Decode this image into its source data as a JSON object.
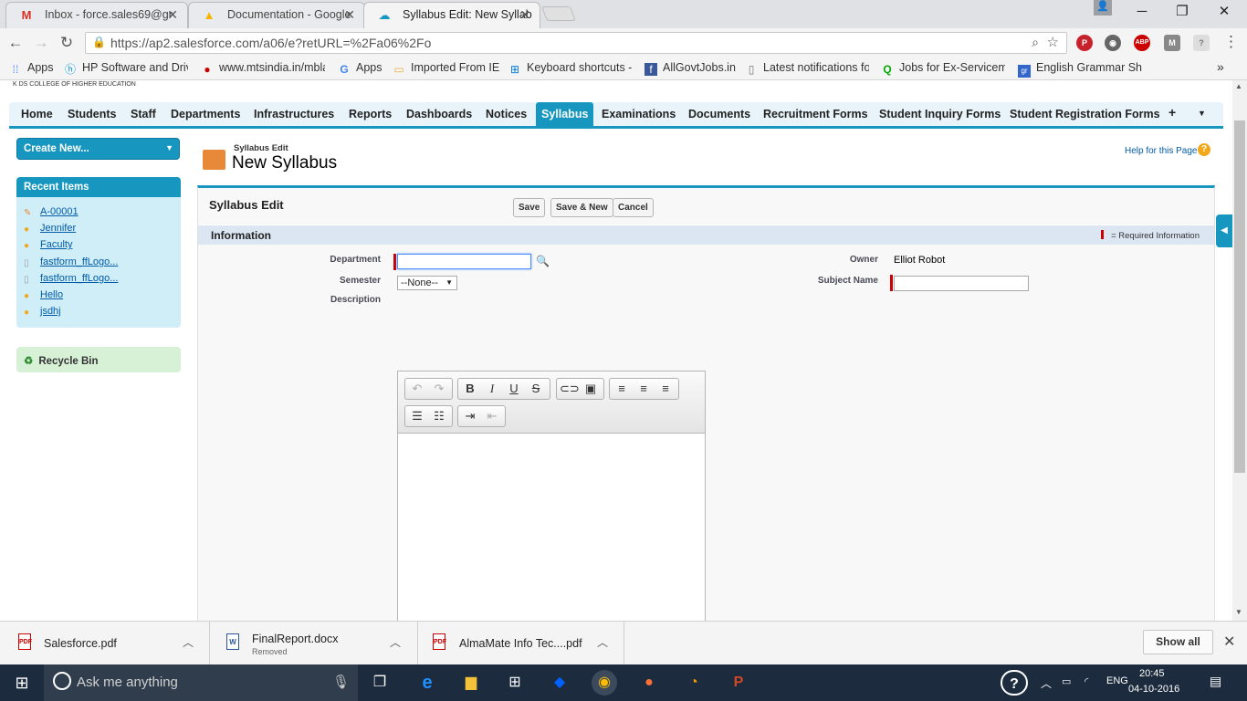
{
  "browser": {
    "tabs": [
      {
        "title": "Inbox - force.sales69@gr",
        "icon": "gmail-icon"
      },
      {
        "title": "Documentation - Google",
        "icon": "drive-icon"
      },
      {
        "title": "Syllabus Edit: New Syllab",
        "icon": "salesforce-icon"
      }
    ],
    "url": "https://ap2.salesforce.com/a06/e?retURL=%2Fa06%2Fo",
    "bookmarks": [
      {
        "label": "Apps"
      },
      {
        "label": "HP Software and Drive"
      },
      {
        "label": "www.mtsindia.in/mbla"
      },
      {
        "label": "Apps"
      },
      {
        "label": "Imported From IE"
      },
      {
        "label": "Keyboard shortcuts - W"
      },
      {
        "label": "AllGovtJobs.in"
      },
      {
        "label": "Latest notifications fo"
      },
      {
        "label": "Jobs for Ex-Serviceme"
      },
      {
        "label": "English Grammar Sho"
      }
    ],
    "bookmarks_more": "»",
    "ext_abp": "ABP"
  },
  "app": {
    "org_name": "K DS COLLEGE OF HIGHER EDUCATION",
    "tabs": [
      "Home",
      "Students",
      "Staff",
      "Departments",
      "Infrastructures",
      "Reports",
      "Dashboards",
      "Notices",
      "Syllabus",
      "Examinations",
      "Documents",
      "Recruitment Forms",
      "Student Inquiry Forms",
      "Student Registration Forms"
    ],
    "active_tab": "Syllabus",
    "plus": "+",
    "more": "▼"
  },
  "sidebar": {
    "create_new": "Create New...",
    "recent_title": "Recent Items",
    "recent_items": [
      "A-00001",
      "Jennifer",
      "Faculty",
      "fastform_ffLogo...",
      "fastform_ffLogo...",
      "Hello",
      "jsdhj"
    ],
    "recycle_bin": "Recycle Bin"
  },
  "main": {
    "breadcrumb": "Syllabus Edit",
    "title": "New Syllabus",
    "help_link": "Help for this Page",
    "panel_title": "Syllabus Edit",
    "buttons": {
      "save": "Save",
      "save_new": "Save & New",
      "cancel": "Cancel"
    },
    "section_title": "Information",
    "required_info": "= Required Information",
    "fields": {
      "department_label": "Department",
      "department_value": "",
      "semester_label": "Semester",
      "semester_value": "--None--",
      "description_label": "Description",
      "owner_label": "Owner",
      "owner_value": "Elliot Robot",
      "subject_label": "Subject Name",
      "subject_value": ""
    }
  },
  "downloads": [
    {
      "name": "Salesforce.pdf",
      "status": ""
    },
    {
      "name": "FinalReport.docx",
      "status": "Removed"
    },
    {
      "name": "AlmaMate Info Tec....pdf",
      "status": ""
    }
  ],
  "downloads_show_all": "Show all",
  "taskbar": {
    "search_placeholder": "Ask me anything",
    "lang": "ENG",
    "time": "20:45",
    "date": "04-10-2016"
  }
}
